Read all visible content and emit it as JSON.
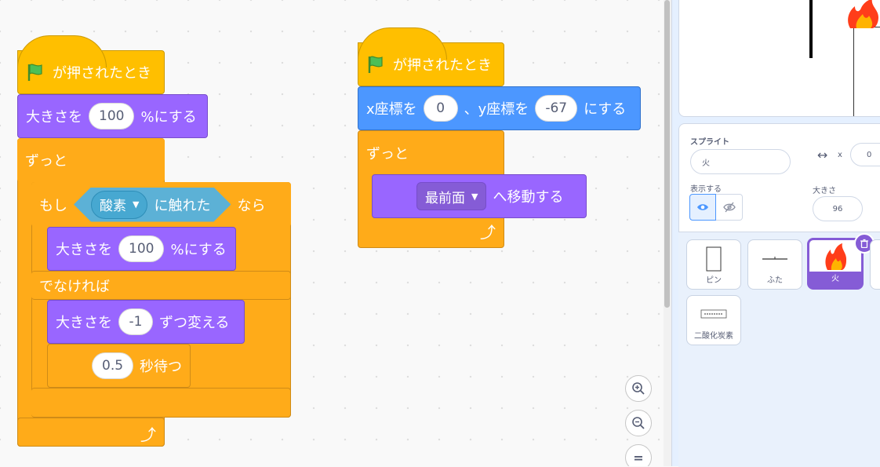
{
  "scripts": {
    "s1": {
      "hat_label": "が押されたとき",
      "set_size_prefix": "大きさを",
      "set_size_value": "100",
      "set_size_suffix": "%にする",
      "forever_label": "ずっと",
      "if_label": "もし",
      "sensing_menu": "酸素",
      "touching_label": "に触れた",
      "then_label": "なら",
      "inner_set_size_prefix": "大きさを",
      "inner_set_size_value": "100",
      "inner_set_size_suffix": "%にする",
      "else_label": "でなければ",
      "change_size_prefix": "大きさを",
      "change_size_value": "-1",
      "change_size_suffix": "ずつ変える",
      "wait_value": "0.5",
      "wait_suffix": "秒待つ"
    },
    "s2": {
      "hat_label": "が押されたとき",
      "x_prefix": "x座標を",
      "x_value": "0",
      "y_prefix": "、y座標を",
      "y_value": "-67",
      "xy_suffix": "にする",
      "forever_label": "ずっと",
      "layer_menu": "最前面",
      "layer_suffix": "へ移動する"
    }
  },
  "sprite_info": {
    "sprite_label": "スプライト",
    "sprite_name": "火",
    "x_icon": "↔",
    "x_label": "x",
    "x_value": "0",
    "show_label": "表示する",
    "size_label": "大きさ",
    "size_value": "96"
  },
  "sprites": [
    {
      "name": "ピン"
    },
    {
      "name": "ふた"
    },
    {
      "name": "火"
    },
    {
      "name": "二酸化炭素"
    }
  ],
  "zoom": {
    "reset_label": "="
  },
  "colors": {
    "events": "#ffbf00",
    "control": "#ffab19",
    "looks": "#9966ff",
    "motion": "#4c97ff",
    "sensing": "#5cb1d6",
    "selected": "#855cd6"
  }
}
